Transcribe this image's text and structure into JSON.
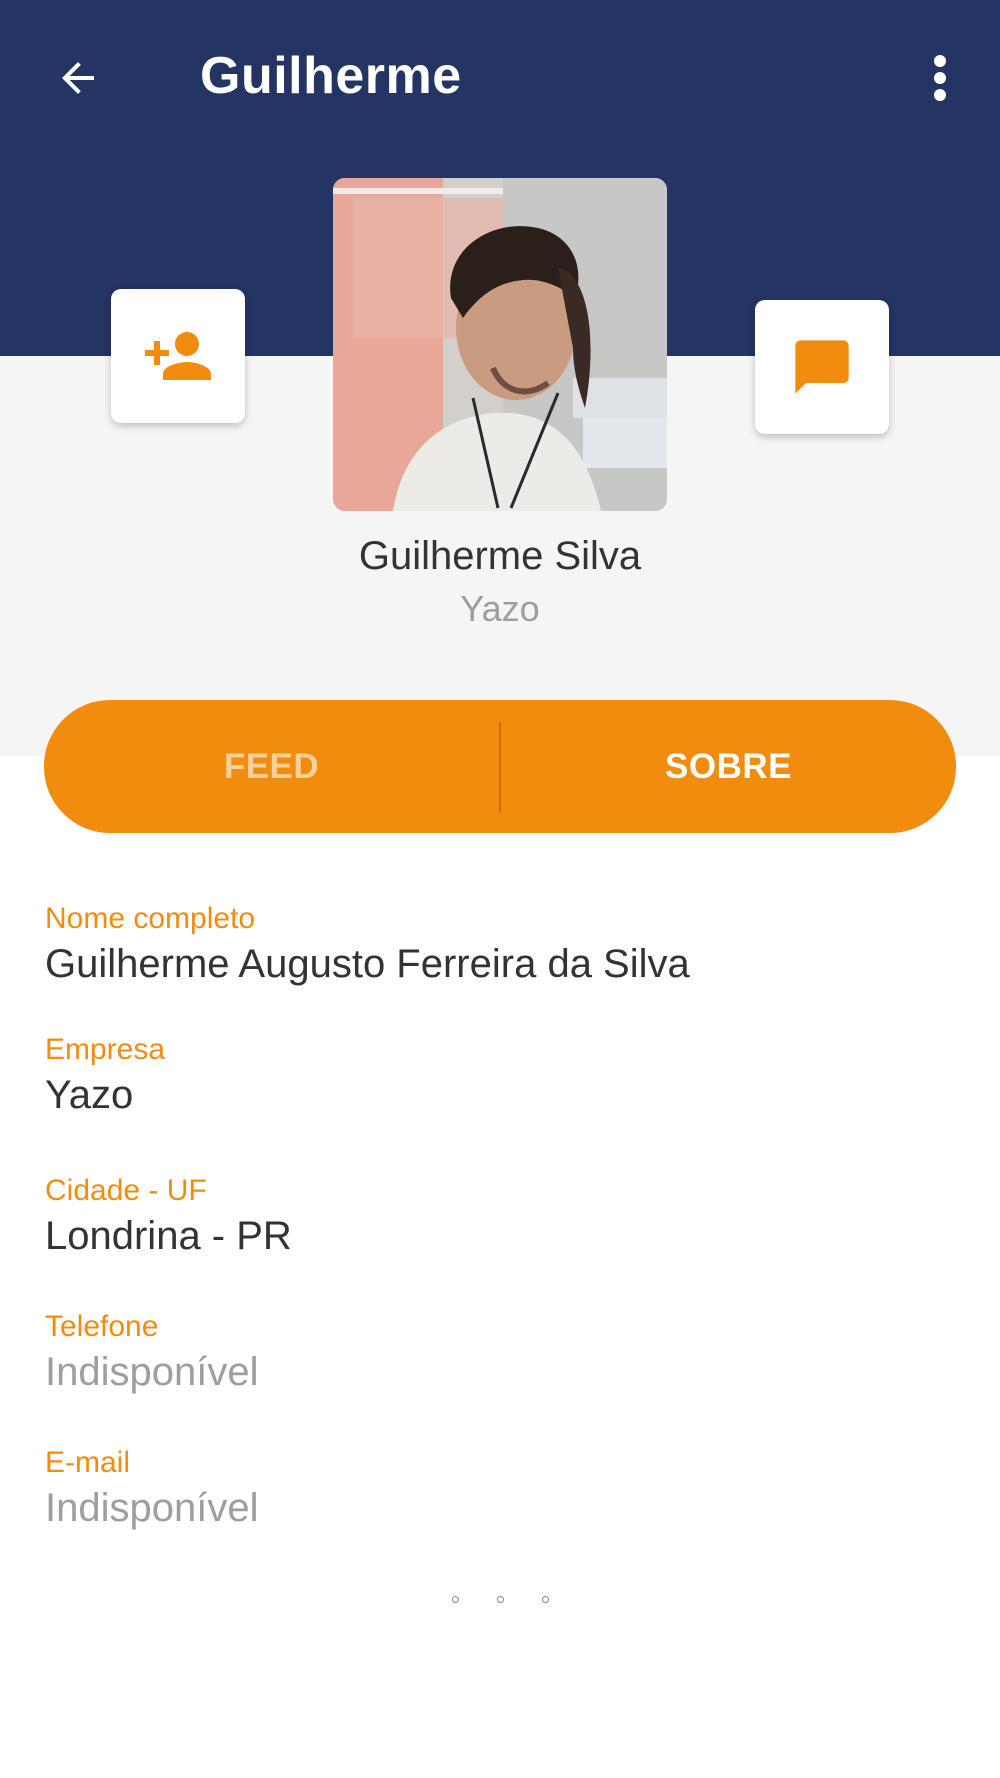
{
  "appbar": {
    "title": "Guilherme",
    "back_icon": "arrow-back-icon",
    "more_icon": "more-vert-icon",
    "background": "#243463"
  },
  "profile": {
    "name": "Guilherme Silva",
    "company": "Yazo",
    "add_contact_icon": "person-add-icon",
    "chat_icon": "chat-bubble-icon"
  },
  "tabs": [
    {
      "label": "FEED",
      "selected": false
    },
    {
      "label": "SOBRE",
      "selected": true
    }
  ],
  "fields": [
    {
      "label": "Nome completo",
      "value": "Guilherme Augusto Ferreira da Silva",
      "available": true
    },
    {
      "label": "Empresa",
      "value": "Yazo",
      "available": true
    },
    {
      "label": "Cidade - UF",
      "value": "Londrina - PR",
      "available": true
    },
    {
      "label": "Telefone",
      "value": "Indisponível",
      "available": false
    },
    {
      "label": "E-mail",
      "value": "Indisponível",
      "available": false
    }
  ],
  "colors": {
    "accent": "#f28c0e",
    "primary_dark": "#243463",
    "text": "#333333",
    "muted": "#9e9e9e"
  }
}
